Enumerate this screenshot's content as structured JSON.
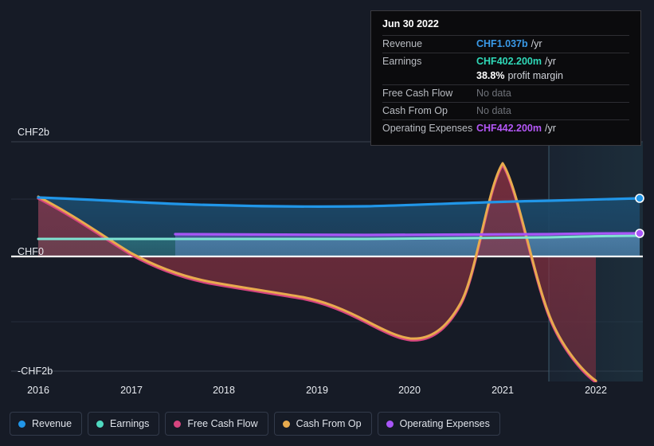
{
  "theme": {
    "background": "#161b26",
    "zero_line": "#ffffff",
    "grid": "#2b3240",
    "text": "#e9ecf1"
  },
  "series_colors": {
    "revenue": "#2196e8",
    "earnings": "#4fd9c0",
    "free_cash_flow": "#d6457f",
    "cash_from_op": "#e8ab4e",
    "operating_expenses": "#a855f7"
  },
  "tooltip": {
    "date": "Jun 30 2022",
    "rows": [
      {
        "label": "Revenue",
        "value": "CHF1.037b",
        "unit": "/yr",
        "color": "#3a9ae8",
        "no_data": false
      },
      {
        "label": "Earnings",
        "value": "CHF402.200m",
        "unit": "/yr",
        "color": "#2fd9b8",
        "no_data": false
      },
      {
        "label": "Free Cash Flow",
        "value": "No data",
        "unit": "",
        "color": "#6f7279",
        "no_data": true
      },
      {
        "label": "Cash From Op",
        "value": "No data",
        "unit": "",
        "color": "#6f7279",
        "no_data": true
      },
      {
        "label": "Operating Expenses",
        "value": "CHF442.200m",
        "unit": "/yr",
        "color": "#b457f7",
        "no_data": false
      }
    ],
    "profit_margin_value": "38.8%",
    "profit_margin_label": "profit margin"
  },
  "legend": [
    {
      "label": "Revenue",
      "color": "#2196e8"
    },
    {
      "label": "Earnings",
      "color": "#4fd9c0"
    },
    {
      "label": "Free Cash Flow",
      "color": "#d6457f"
    },
    {
      "label": "Cash From Op",
      "color": "#e8ab4e"
    },
    {
      "label": "Operating Expenses",
      "color": "#a855f7"
    }
  ],
  "axes": {
    "y_labels": [
      {
        "text": "CHF2b",
        "value": 2
      },
      {
        "text": "CHF0",
        "value": 0
      },
      {
        "text": "-CHF2b",
        "value": -2
      }
    ],
    "x_labels": [
      "2016",
      "2017",
      "2018",
      "2019",
      "2020",
      "2021",
      "2022"
    ],
    "ylim": [
      -2.7,
      2.0
    ],
    "xlim": [
      "2016",
      "2022.5"
    ]
  },
  "chart_data": {
    "type": "area",
    "title": "",
    "xlabel": "",
    "ylabel": "CHF",
    "ylim": [
      -2.7,
      2.0
    ],
    "grid": true,
    "legend_position": "bottom",
    "x": [
      "2016",
      "2017",
      "2018",
      "2019",
      "2020",
      "2021",
      "2022"
    ],
    "categories": [
      "2016",
      "2017",
      "2018",
      "2019",
      "2020",
      "2021",
      "2022"
    ],
    "series": [
      {
        "name": "Revenue",
        "color": "#2196e8",
        "unit": "CHF b",
        "values": [
          0.93,
          0.9,
          0.88,
          0.87,
          0.87,
          0.9,
          1.037
        ]
      },
      {
        "name": "Earnings",
        "color": "#4fd9c0",
        "unit": "CHF b",
        "values": [
          0.29,
          0.29,
          0.29,
          0.29,
          0.3,
          0.33,
          0.402
        ]
      },
      {
        "name": "Free Cash Flow",
        "color": "#d6457f",
        "unit": "CHF b",
        "values": [
          0.93,
          0.15,
          -0.3,
          -0.45,
          -1.12,
          1.48,
          -1.72
        ]
      },
      {
        "name": "Cash From Op",
        "color": "#e8ab4e",
        "unit": "CHF b",
        "values": [
          0.93,
          0.15,
          -0.3,
          -0.45,
          -1.12,
          1.5,
          -1.7
        ]
      },
      {
        "name": "Operating Expenses",
        "color": "#a855f7",
        "unit": "CHF b",
        "values": [
          null,
          0.37,
          0.37,
          0.37,
          0.37,
          0.39,
          0.442
        ]
      }
    ],
    "annotations": {
      "highlight_band_start": "2021.9",
      "endpoint_markers": [
        "Revenue",
        "Operating Expenses"
      ]
    }
  }
}
